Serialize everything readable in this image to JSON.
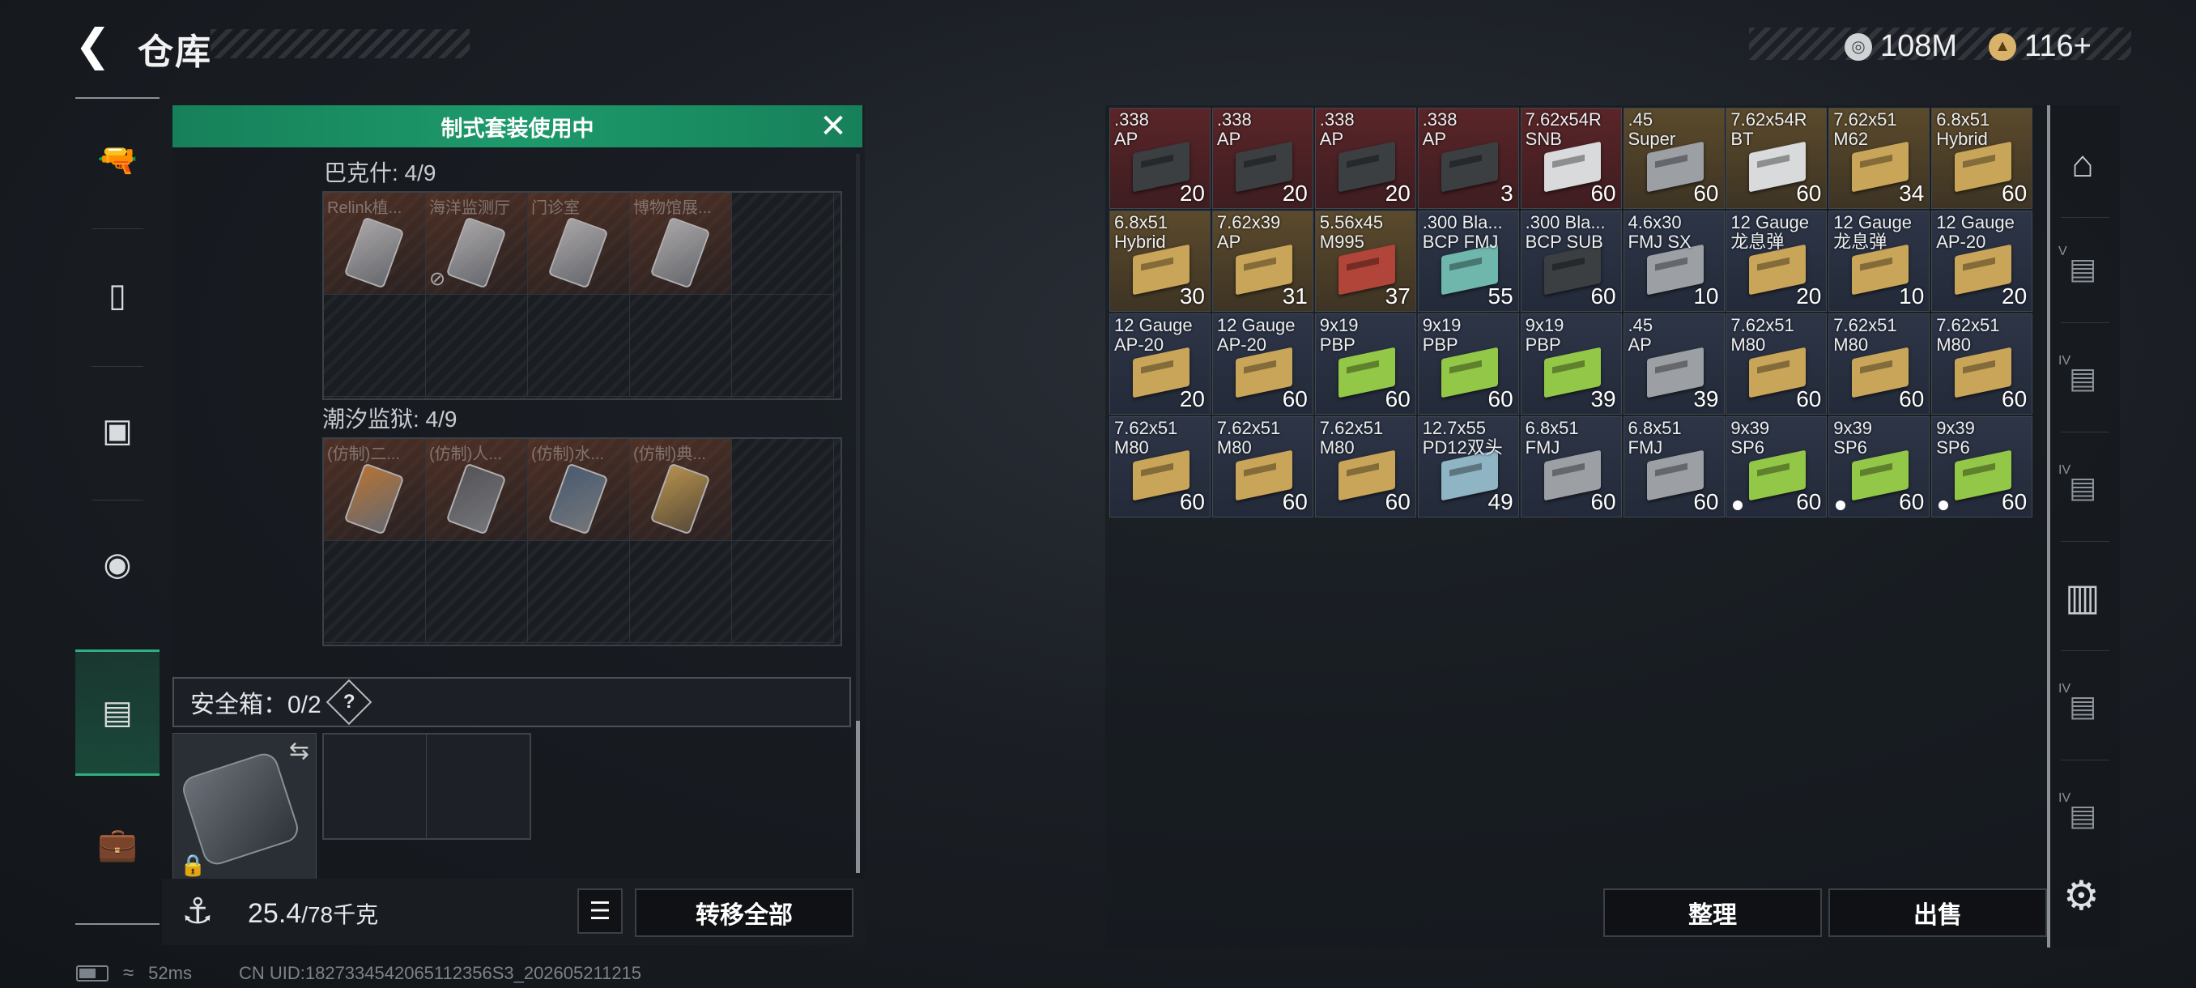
{
  "header": {
    "back_icon": "back-arrow-icon",
    "title": "仓库",
    "currency": [
      {
        "icon": "silver-coin-icon",
        "value": "108M"
      },
      {
        "icon": "gold-coin-icon",
        "value": "116+"
      }
    ]
  },
  "nav": [
    "gun-icon",
    "vest-icon",
    "backpack-icon",
    "helmet-icon",
    "container-icon",
    "toolbox-icon"
  ],
  "banner": {
    "text": "制式套装使用中",
    "close_icon": "close-icon"
  },
  "sections": [
    {
      "title": "巴克什: 4/9",
      "items": [
        "Relink植...",
        "海洋监测厅",
        "门诊室",
        "博物馆展..."
      ]
    },
    {
      "title": "潮汐监狱: 4/9",
      "items": [
        "(仿制)二...",
        "(仿制)人...",
        "(仿制)水...",
        "(仿制)典..."
      ]
    }
  ],
  "safe": {
    "label": "安全箱：0/2",
    "help": "?",
    "swap_icon": "swap-icon",
    "lock_icon": "lock-icon"
  },
  "weight": {
    "current": "25.4",
    "max": "/78千克"
  },
  "buttons": {
    "transfer_all": "转移全部",
    "sort": "整理",
    "sell": "出售"
  },
  "ammo": [
    {
      "name": ".338\nAP",
      "qty": "20",
      "bg": "red",
      "box": "dark"
    },
    {
      "name": ".338\nAP",
      "qty": "20",
      "bg": "red",
      "box": "dark"
    },
    {
      "name": ".338\nAP",
      "qty": "20",
      "bg": "red",
      "box": "dark"
    },
    {
      "name": ".338\nAP",
      "qty": "3",
      "bg": "red",
      "box": "dark"
    },
    {
      "name": "7.62x54R\nSNB",
      "qty": "60",
      "bg": "red",
      "box": "white"
    },
    {
      "name": ".45\nSuper",
      "qty": "60",
      "bg": "gold",
      "box": "grey"
    },
    {
      "name": "7.62x54R\nBT",
      "qty": "60",
      "bg": "gold",
      "box": "white"
    },
    {
      "name": "7.62x51\nM62",
      "qty": "34",
      "bg": "gold",
      "box": "tan"
    },
    {
      "name": "6.8x51\nHybrid",
      "qty": "60",
      "bg": "gold",
      "box": "tan"
    },
    {
      "name": "6.8x51\nHybrid",
      "qty": "30",
      "bg": "gold",
      "box": "tan"
    },
    {
      "name": "7.62x39\nAP",
      "qty": "31",
      "bg": "gold",
      "box": "tan"
    },
    {
      "name": "5.56x45\nM995",
      "qty": "37",
      "bg": "gold",
      "box": "red"
    },
    {
      "name": ".300 Bla...\nBCP FMJ",
      "qty": "55",
      "bg": "blue",
      "box": "teal"
    },
    {
      "name": ".300 Bla...\nBCP SUB",
      "qty": "60",
      "bg": "blue",
      "box": "dark"
    },
    {
      "name": "4.6x30\nFMJ SX",
      "qty": "10",
      "bg": "blue",
      "box": "grey"
    },
    {
      "name": "12 Gauge\n龙息弹",
      "qty": "20",
      "bg": "blue",
      "box": "tan"
    },
    {
      "name": "12 Gauge\n龙息弹",
      "qty": "10",
      "bg": "blue",
      "box": "tan"
    },
    {
      "name": "12 Gauge\nAP-20",
      "qty": "20",
      "bg": "blue",
      "box": "tan"
    },
    {
      "name": "12 Gauge\nAP-20",
      "qty": "20",
      "bg": "blue",
      "box": "tan"
    },
    {
      "name": "12 Gauge\nAP-20",
      "qty": "60",
      "bg": "blue",
      "box": "tan"
    },
    {
      "name": "9x19\nPBP",
      "qty": "60",
      "bg": "blue",
      "box": "green"
    },
    {
      "name": "9x19\nPBP",
      "qty": "60",
      "bg": "blue",
      "box": "green"
    },
    {
      "name": "9x19\nPBP",
      "qty": "39",
      "bg": "blue",
      "box": "green"
    },
    {
      "name": ".45\nAP",
      "qty": "39",
      "bg": "blue",
      "box": "grey"
    },
    {
      "name": "7.62x51\nM80",
      "qty": "60",
      "bg": "blue",
      "box": "tan"
    },
    {
      "name": "7.62x51\nM80",
      "qty": "60",
      "bg": "blue",
      "box": "tan"
    },
    {
      "name": "7.62x51\nM80",
      "qty": "60",
      "bg": "blue",
      "box": "tan"
    },
    {
      "name": "7.62x51\nM80",
      "qty": "60",
      "bg": "blue",
      "box": "tan"
    },
    {
      "name": "7.62x51\nM80",
      "qty": "60",
      "bg": "blue",
      "box": "tan"
    },
    {
      "name": "7.62x51\nM80",
      "qty": "60",
      "bg": "blue",
      "box": "tan"
    },
    {
      "name": "12.7x55\nPD12双头",
      "qty": "49",
      "bg": "blue",
      "box": "blue"
    },
    {
      "name": "6.8x51\nFMJ",
      "qty": "60",
      "bg": "blue",
      "box": "grey"
    },
    {
      "name": "6.8x51\nFMJ",
      "qty": "60",
      "bg": "blue",
      "box": "grey"
    },
    {
      "name": "9x39\nSP6",
      "qty": "60",
      "bg": "blue",
      "box": "green",
      "dot": true
    },
    {
      "name": "9x39\nSP6",
      "qty": "60",
      "bg": "blue",
      "box": "green",
      "dot": true
    },
    {
      "name": "9x39\nSP6",
      "qty": "60",
      "bg": "blue",
      "box": "green",
      "dot": true
    }
  ],
  "right_sidebar": [
    {
      "icon": "helmet-side-icon",
      "tier": ""
    },
    {
      "icon": "case-tier-v-icon",
      "tier": "V"
    },
    {
      "icon": "case-tier-iv-icon",
      "tier": "IV"
    },
    {
      "icon": "case-tier-iv-icon",
      "tier": "IV"
    },
    {
      "icon": "folder-stack-icon",
      "tier": ""
    },
    {
      "icon": "case-tier-iv-icon",
      "tier": "IV"
    },
    {
      "icon": "case-tier-iv-icon",
      "tier": "IV"
    }
  ],
  "status": {
    "ping": "52ms",
    "uid": "CN UID:1827334542065112356S3_202605211215"
  },
  "colors": {
    "banner_green": "#1d9a6b",
    "accent_green": "#2fb07e"
  }
}
